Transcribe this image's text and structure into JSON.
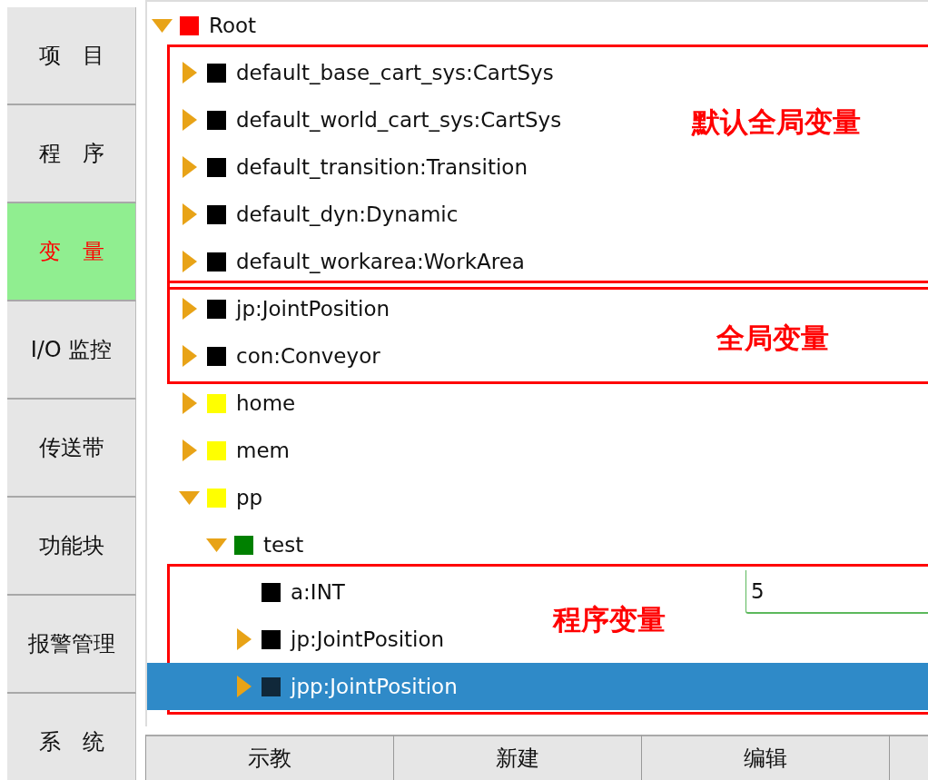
{
  "sidebar": {
    "items": [
      {
        "label": "项　目",
        "selected": false
      },
      {
        "label": "程　序",
        "selected": false
      },
      {
        "label": "变　量",
        "selected": true
      },
      {
        "label": "I/O 监控",
        "selected": false
      },
      {
        "label": "传送带",
        "selected": false
      },
      {
        "label": "功能块",
        "selected": false
      },
      {
        "label": "报警管理",
        "selected": false
      },
      {
        "label": "系　统",
        "selected": false
      }
    ]
  },
  "tree": {
    "kind": "branch",
    "label": "Root",
    "color": "#ff0000",
    "expanded": true,
    "selected": false,
    "children": [
      {
        "kind": "group",
        "label": "默认全局变量",
        "children": [
          {
            "kind": "branch",
            "label": "default_base_cart_sys:CartSys",
            "color": "#000000",
            "expanded": false,
            "selected": false
          },
          {
            "kind": "branch",
            "label": "default_world_cart_sys:CartSys",
            "color": "#000000",
            "expanded": false,
            "selected": false
          },
          {
            "kind": "branch",
            "label": "default_transition:Transition",
            "color": "#000000",
            "expanded": false,
            "selected": false
          },
          {
            "kind": "branch",
            "label": "default_dyn:Dynamic",
            "color": "#000000",
            "expanded": false,
            "selected": false
          },
          {
            "kind": "branch",
            "label": "default_workarea:WorkArea",
            "color": "#000000",
            "expanded": false,
            "selected": false
          }
        ]
      },
      {
        "kind": "group",
        "label": "全局变量",
        "children": [
          {
            "kind": "branch",
            "label": "jp:JointPosition",
            "color": "#000000",
            "expanded": false,
            "selected": false
          },
          {
            "kind": "branch",
            "label": "con:Conveyor",
            "color": "#000000",
            "expanded": false,
            "selected": false
          }
        ]
      },
      {
        "kind": "branch",
        "label": "home",
        "color": "#ffff00",
        "expanded": false,
        "selected": false
      },
      {
        "kind": "branch",
        "label": "mem",
        "color": "#ffff00",
        "expanded": false,
        "selected": false
      },
      {
        "kind": "branch",
        "label": "pp",
        "color": "#ffff00",
        "expanded": true,
        "selected": false,
        "children": [
          {
            "kind": "branch",
            "label": "test",
            "color": "#008000",
            "expanded": true,
            "selected": false,
            "children": [
              {
                "kind": "group",
                "label": "程序变量",
                "children": [
                  {
                    "kind": "leaf",
                    "label": "a:INT",
                    "color": "#000000",
                    "value": "5",
                    "selected": false
                  },
                  {
                    "kind": "branch",
                    "label": "jp:JointPosition",
                    "color": "#000000",
                    "expanded": false,
                    "selected": false
                  },
                  {
                    "kind": "branch",
                    "label": "jpp:JointPosition",
                    "color": "#10283a",
                    "expanded": false,
                    "selected": true
                  }
                ]
              }
            ]
          }
        ]
      }
    ]
  },
  "buttons": [
    "示教",
    "新建",
    "编辑"
  ]
}
